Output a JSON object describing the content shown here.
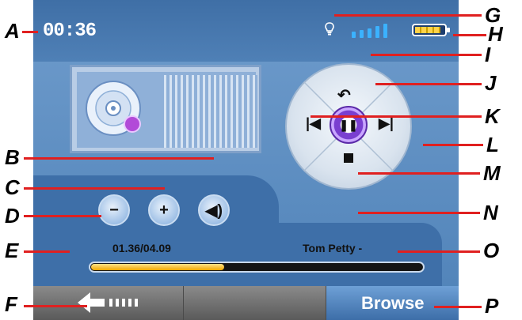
{
  "status": {
    "time": "00:36",
    "signal_bars": 5,
    "battery_level": 0.9
  },
  "transport": {
    "current_time": "01.36/04.09",
    "track_title": "Tom Petty -",
    "progress": 0.4
  },
  "bottom": {
    "browse_label": "Browse"
  },
  "callouts": [
    "A",
    "B",
    "C",
    "D",
    "E",
    "F",
    "G",
    "H",
    "I",
    "J",
    "K",
    "L",
    "M",
    "N",
    "O",
    "P"
  ],
  "colors": {
    "accent_blue": "#4f82b8",
    "callout_red": "#e02020",
    "progress_fill": "#f0a800"
  },
  "icons": {
    "bulb": "lightbulb-icon",
    "signal": "signal-icon",
    "battery": "battery-icon",
    "album": "cd-icon",
    "back": "back-arrow-icon",
    "prev": "previous-icon",
    "next": "next-icon",
    "pause": "pause-icon",
    "stop": "stop-icon",
    "volume_down": "volume-down-icon",
    "volume_up": "volume-up-icon",
    "mute": "speaker-icon"
  }
}
